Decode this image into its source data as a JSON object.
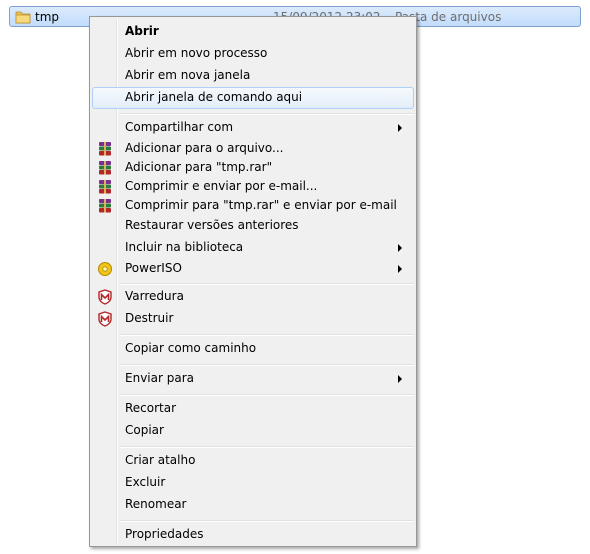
{
  "file_row": {
    "name": "tmp",
    "date": "15/09/2012 23:02",
    "type": "Pasta de arquivos"
  },
  "menu": {
    "abrir": "Abrir",
    "abrir_novo_processo": "Abrir em novo processo",
    "abrir_nova_janela": "Abrir em nova janela",
    "abrir_janela_comando": "Abrir janela de comando aqui",
    "compartilhar_com": "Compartilhar com",
    "adicionar_arquivo": "Adicionar para o arquivo...",
    "adicionar_tmp_rar": "Adicionar para \"tmp.rar\"",
    "comprimir_enviar_email": "Comprimir e enviar por e-mail...",
    "comprimir_tmp_rar_email": "Comprimir para \"tmp.rar\" e enviar por e-mail",
    "restaurar_versoes": "Restaurar versões anteriores",
    "incluir_biblioteca": "Incluir na biblioteca",
    "poweriso": "PowerISO",
    "varredura": "Varredura",
    "destruir": "Destruir",
    "copiar_caminho": "Copiar como caminho",
    "enviar_para": "Enviar para",
    "recortar": "Recortar",
    "copiar": "Copiar",
    "criar_atalho": "Criar atalho",
    "excluir": "Excluir",
    "renomear": "Renomear",
    "propriedades": "Propriedades"
  },
  "icons": {
    "folder": "folder-icon",
    "winrar": "winrar-icon",
    "poweriso": "poweriso-icon",
    "mcafee": "mcafee-shield-icon",
    "submenu": "submenu-arrow-icon"
  },
  "colors": {
    "menu_background": "#f0f0f0",
    "hover_border": "#aecff7",
    "selection_fill": "#c1dcfc"
  }
}
